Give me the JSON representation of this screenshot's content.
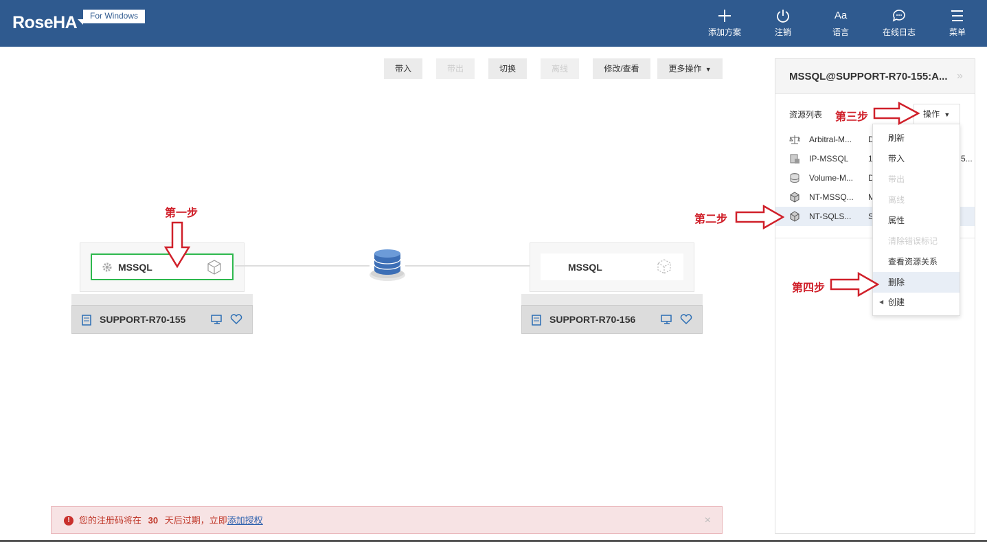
{
  "header": {
    "logo": "RoseHA",
    "logo_tag": "For Windows",
    "nav": [
      {
        "label": "添加方案",
        "icon": "plus-icon"
      },
      {
        "label": "注销",
        "icon": "power-icon"
      },
      {
        "label": "语言",
        "icon": "language-icon",
        "glyph": "Aa"
      },
      {
        "label": "在线日志",
        "icon": "chat-icon"
      },
      {
        "label": "菜单",
        "icon": "menu-icon"
      }
    ]
  },
  "toolbar": {
    "bring_in": "带入",
    "bring_out": "带出",
    "switch": "切换",
    "offline": "离线",
    "modify_view": "修改/查看",
    "more_ops": "更多操作"
  },
  "topology": {
    "left_resource": "MSSQL",
    "left_host": "SUPPORT-R70-155",
    "right_resource": "MSSQL",
    "right_host": "SUPPORT-R70-156"
  },
  "side_panel": {
    "title": "MSSQL@SUPPORT-R70-155:A...",
    "resource_list_label": "资源列表",
    "ops_button": "操作",
    "resources": [
      {
        "name": "Arbitral-M...",
        "value": "D",
        "icon": "scale-icon"
      },
      {
        "name": "IP-MSSQL",
        "value": "1",
        "extra": "5...",
        "icon": "ip-icon"
      },
      {
        "name": "Volume-M...",
        "value": "D",
        "icon": "volume-icon"
      },
      {
        "name": "NT-MSSQ...",
        "value": "M",
        "icon": "cube-icon"
      },
      {
        "name": "NT-SQLS...",
        "value": "S",
        "icon": "cube-icon"
      }
    ]
  },
  "dropdown": {
    "items": [
      {
        "label": "刷新",
        "disabled": false
      },
      {
        "label": "带入",
        "disabled": false
      },
      {
        "label": "带出",
        "disabled": true
      },
      {
        "label": "离线",
        "disabled": true
      },
      {
        "label": "属性",
        "disabled": false
      },
      {
        "label": "清除错误标记",
        "disabled": true
      },
      {
        "label": "查看资源关系",
        "disabled": false
      },
      {
        "label": "删除",
        "disabled": false
      },
      {
        "label": "创建",
        "disabled": false
      }
    ]
  },
  "annotations": {
    "step1": "第一步",
    "step2": "第二步",
    "step3": "第三步",
    "step4": "第四步"
  },
  "alert": {
    "prefix": "您的注册码将在",
    "days": "30",
    "suffix": "天后过期，立即",
    "link": "添加授权",
    "close": "×"
  },
  "colors": {
    "header_bg": "#2f5a8f",
    "annotation_red": "#d0202a",
    "selected_border": "#2db84d",
    "icon_blue": "#2a6db3"
  }
}
